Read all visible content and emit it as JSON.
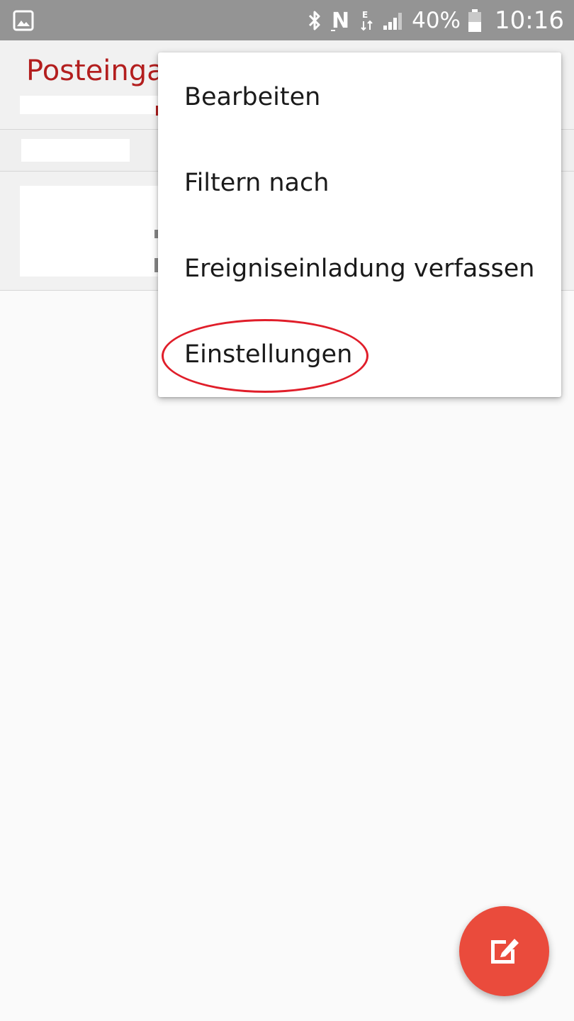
{
  "status_bar": {
    "battery_percent": "40%",
    "time": "10:16",
    "icons": [
      "gallery-icon",
      "bluetooth-icon",
      "nfc-icon",
      "data-transfer-icon",
      "signal-icon",
      "battery-icon"
    ]
  },
  "header": {
    "title": "Posteinga",
    "title_color": "#b31e1e"
  },
  "menu": {
    "items": [
      {
        "label": "Bearbeiten"
      },
      {
        "label": "Filtern nach"
      },
      {
        "label": "Ereigniseinladung verfassen"
      },
      {
        "label": "Einstellungen",
        "highlighted": true
      }
    ],
    "highlight_color": "#e01e2a"
  },
  "fab": {
    "icon": "compose-icon",
    "color": "#ea4b3c"
  }
}
